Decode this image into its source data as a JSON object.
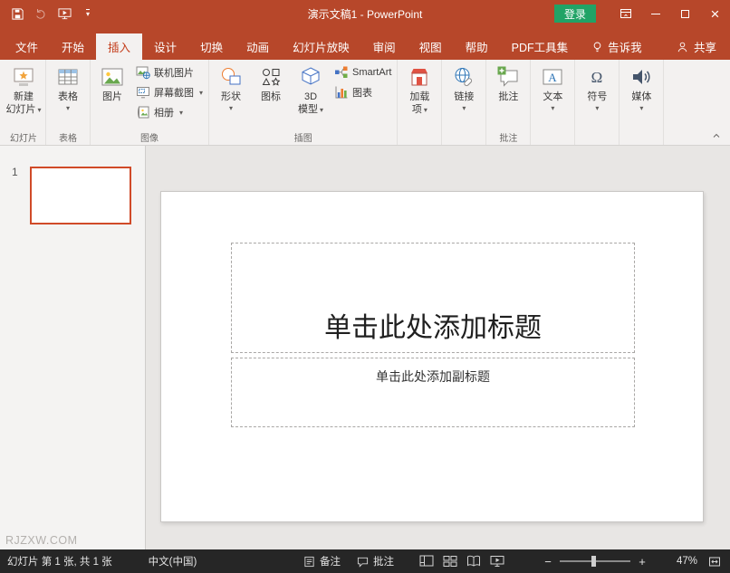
{
  "titlebar": {
    "document_title": "演示文稿1 - PowerPoint",
    "login_label": "登录"
  },
  "tabs": {
    "file": "文件",
    "ribbon": [
      "开始",
      "插入",
      "设计",
      "切换",
      "动画",
      "幻灯片放映",
      "审阅",
      "视图",
      "帮助",
      "PDF工具集"
    ],
    "active_tab": "插入",
    "tell_me": "告诉我",
    "share": "共享"
  },
  "ribbon": {
    "slides_group": {
      "label": "幻灯片",
      "new_slide_line1": "新建",
      "new_slide_line2": "幻灯片"
    },
    "tables_group": {
      "label": "表格",
      "table_label": "表格"
    },
    "images_group": {
      "label": "图像",
      "picture_label": "图片",
      "online_pictures_label": "联机图片",
      "screenshot_label": "屏幕截图",
      "photo_album_label": "相册"
    },
    "illustrations_group": {
      "label": "插图",
      "shapes_label": "形状",
      "icons_label": "图标",
      "model_line1": "3D",
      "model_line2": "模型",
      "smartart_label": "SmartArt",
      "chart_label": "图表"
    },
    "addins_group": {
      "addins_line1": "加载",
      "addins_line2": "项"
    },
    "links_group": {
      "link_label": "链接"
    },
    "comments_group": {
      "label": "批注",
      "comment_label": "批注"
    },
    "text_group": {
      "text_label": "文本"
    },
    "symbols_group": {
      "symbol_label": "符号"
    },
    "media_group": {
      "media_label": "媒体"
    }
  },
  "slide_panel": {
    "slide_number": "1",
    "watermark": "RJZXW.COM"
  },
  "canvas": {
    "title_placeholder": "单击此处添加标题",
    "subtitle_placeholder": "单击此处添加副标题"
  },
  "statusbar": {
    "slide_info": "幻灯片 第 1 张, 共 1 张",
    "language": "中文(中国)",
    "notes_label": "备注",
    "comments_label": "批注",
    "zoom_level": "47%"
  },
  "glyphs": {
    "caret_down": "▾",
    "close": "×",
    "zoom_out": "−",
    "zoom_in": "+"
  },
  "colors": {
    "titlebar_red": "#B7472A",
    "login_green": "#21A366",
    "active_tab_text": "#C43E1C",
    "selected_thumbnail_border": "#D04A28",
    "statusbar_bg": "#262626"
  }
}
